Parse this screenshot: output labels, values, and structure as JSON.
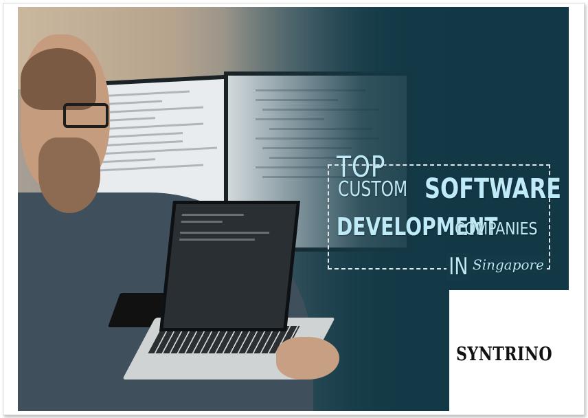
{
  "headline": {
    "line1": "TOP",
    "line2a": "CUSTOM",
    "line2b": "SOFTWARE",
    "line3a": "DEVELOPMENT",
    "line3b": "COMPANIES",
    "line4a": "IN",
    "line4b": "Singapore"
  },
  "logo": {
    "text": "SYNTRINO"
  },
  "colors": {
    "background": "#143a47",
    "headline": "#bfeaf7",
    "logo_text": "#111111"
  }
}
